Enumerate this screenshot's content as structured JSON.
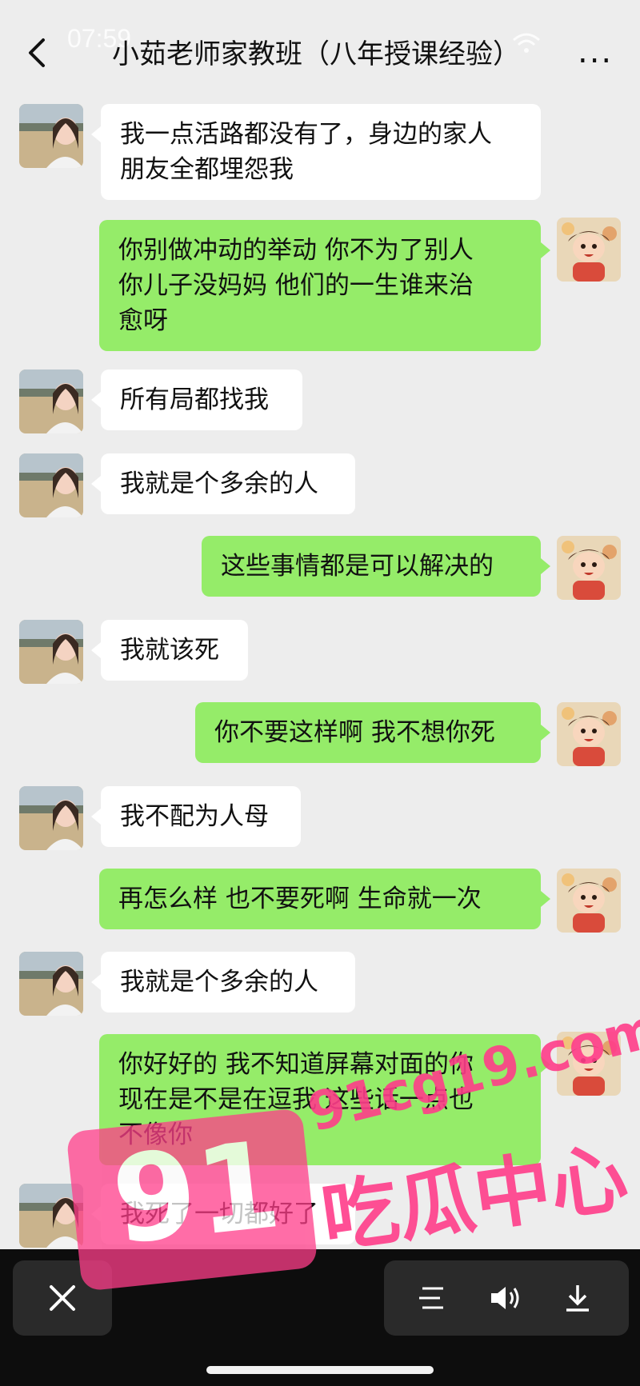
{
  "status_bar": {
    "time": "07:59"
  },
  "header": {
    "title": "小茹老师家教班（八年授课经验）",
    "more": "..."
  },
  "messages": [
    {
      "side": "left",
      "lines": [
        "我一点活路都没有了，身边的家人",
        "朋友全都埋怨我"
      ]
    },
    {
      "side": "right",
      "lines": [
        "你别做冲动的举动 你不为了别人",
        "你儿子没妈妈 他们的一生谁来治",
        "愈呀"
      ]
    },
    {
      "side": "left",
      "lines": [
        "所有局都找我"
      ]
    },
    {
      "side": "left",
      "lines": [
        "我就是个多余的人"
      ]
    },
    {
      "side": "right",
      "lines": [
        "这些事情都是可以解决的"
      ]
    },
    {
      "side": "left",
      "lines": [
        "我就该死"
      ]
    },
    {
      "side": "right",
      "lines": [
        "你不要这样啊 我不想你死"
      ]
    },
    {
      "side": "left",
      "lines": [
        "我不配为人母"
      ]
    },
    {
      "side": "right",
      "lines": [
        "再怎么样 也不要死啊 生命就一次"
      ]
    },
    {
      "side": "left",
      "lines": [
        "我就是个多余的人"
      ]
    },
    {
      "side": "right",
      "lines": [
        "你好好的 我不知道屏幕对面的你",
        "现在是不是在逗我 这些话一点也",
        "不像你"
      ]
    },
    {
      "side": "left",
      "lines": [
        "我死了一切都好了"
      ]
    }
  ],
  "watermark": {
    "domain": "91cg19.com",
    "brand": "吃瓜中心",
    "number": "91"
  },
  "colors": {
    "chat_bg": "#ededed",
    "sent_bubble": "#95ec69",
    "received_bubble": "#ffffff",
    "watermark": "#ff3d8a"
  },
  "icons": [
    "back-arrow-icon",
    "wifi-icon",
    "battery-icon",
    "more-icon",
    "close-icon",
    "list-icon",
    "volume-icon",
    "download-icon"
  ]
}
